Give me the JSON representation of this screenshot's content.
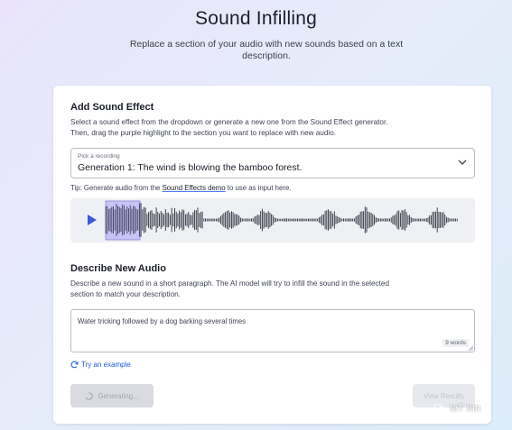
{
  "header": {
    "title": "Sound Infilling",
    "subtitle": "Replace a section of your audio with new sounds based on a text description."
  },
  "sound_effect": {
    "heading": "Add Sound Effect",
    "description": "Select a sound effect from the dropdown or generate a new one from the Sound Effect generator. Then, drag the purple highlight to the section you want to replace with new audio.",
    "select_caption": "Pick a recording",
    "select_value": "Generation 1: The wind is blowing the bamboo forest.",
    "tip_prefix": "Tip: Generate audio from the ",
    "tip_link": "Sound Effects demo",
    "tip_suffix": " to use as input here."
  },
  "waveform": {
    "play_icon": "play-icon",
    "highlight_color": "#c9c3f5",
    "accent_color": "#3a5bd6"
  },
  "new_audio": {
    "heading": "Describe New Audio",
    "description": "Describe a new sound in a short paragraph. The AI model will try to infill the sound in the selected section to match your description.",
    "input_value": "Water tricking followed by a dog barking several times",
    "word_count": "9 words",
    "try_example": "Try an example"
  },
  "buttons": {
    "generating": "Generating...",
    "view_results": "View Results"
  },
  "watermark": "IoT Inn"
}
